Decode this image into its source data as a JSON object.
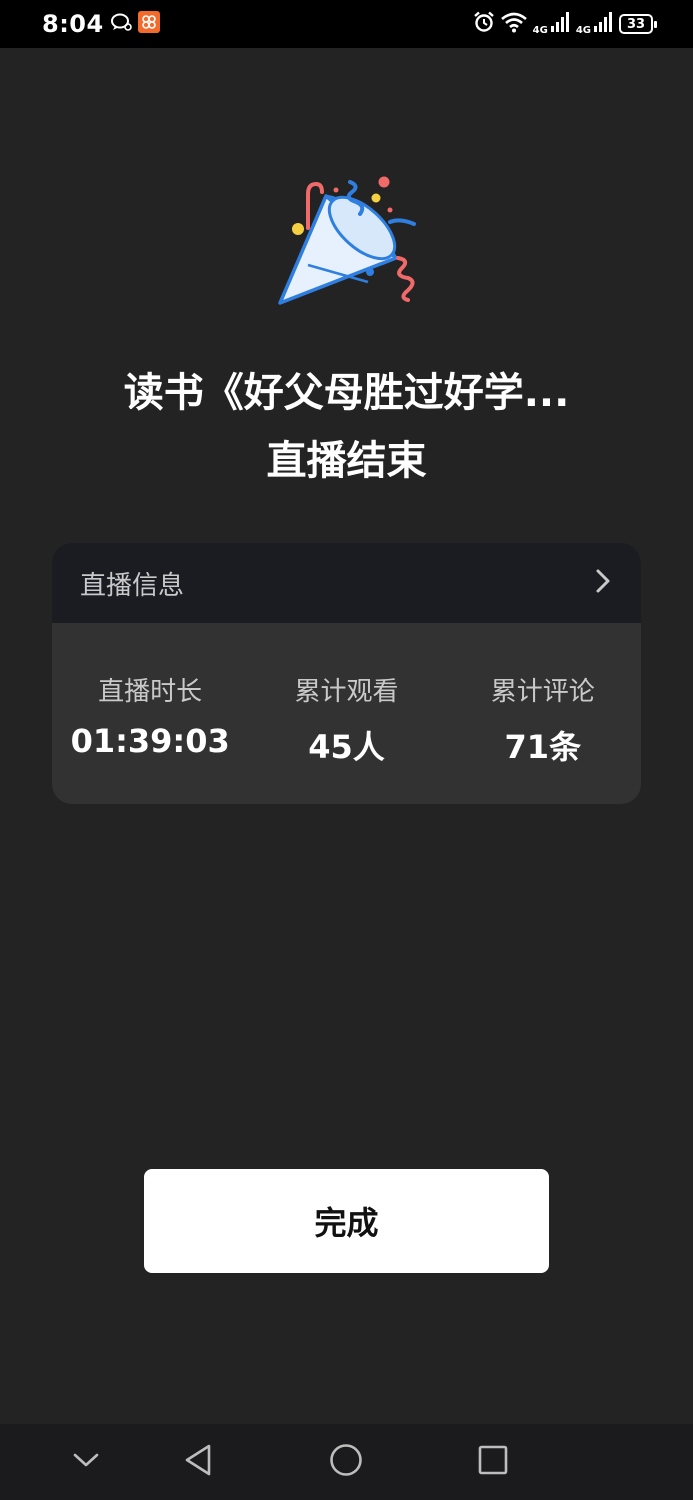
{
  "status_bar": {
    "time": "8:04",
    "network_label_1": "4G",
    "network_label_2": "4G",
    "battery": "33"
  },
  "header": {
    "title_line1": "读书《好父母胜过好学...",
    "title_line2": "直播结束"
  },
  "info_card": {
    "header_label": "直播信息",
    "stats": [
      {
        "label": "直播时长",
        "value": "01:39:03"
      },
      {
        "label": "累计观看",
        "value": "45人"
      },
      {
        "label": "累计评论",
        "value": "71条"
      }
    ]
  },
  "actions": {
    "done_label": "完成"
  },
  "colors": {
    "background": "#232323",
    "card": "#323233",
    "card_header": "#1a1c22",
    "button": "#ffffff",
    "icon_blue": "#2f7fe0",
    "icon_red": "#f06a6a",
    "icon_yellow": "#f5d142"
  }
}
